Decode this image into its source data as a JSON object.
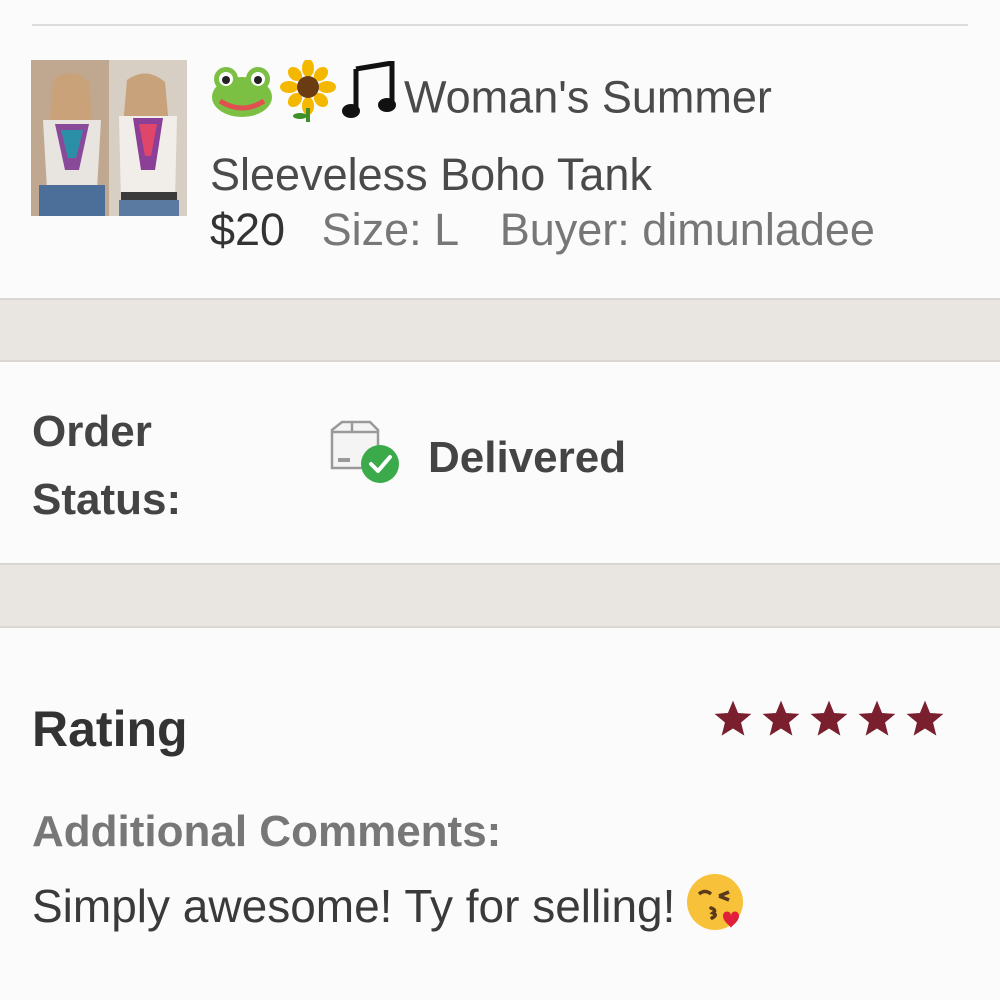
{
  "listing": {
    "title_emoji": [
      "frog-face-icon",
      "sunflower-icon",
      "music-notes-icon"
    ],
    "title": "Woman's Summer Sleeveless Boho Tank",
    "price": "$20",
    "size": "Size: L",
    "buyer": "Buyer: dimunladee"
  },
  "order": {
    "status_label": "Order Status:",
    "status_label_line1": "Order",
    "status_label_line2": "Status:",
    "status_icon": "package-delivered-icon",
    "status_value": "Delivered"
  },
  "feedback": {
    "rating_label": "Rating",
    "rating": 5,
    "rating_max": 5,
    "comments_label": "Additional Comments:",
    "comments_text": "Simply awesome! Ty for selling!",
    "comments_emoji": "kissing-face-icon"
  },
  "colors": {
    "star": "#7a1f2e",
    "delivered_check": "#3aaa4a",
    "divider": "#e9e6e2"
  }
}
